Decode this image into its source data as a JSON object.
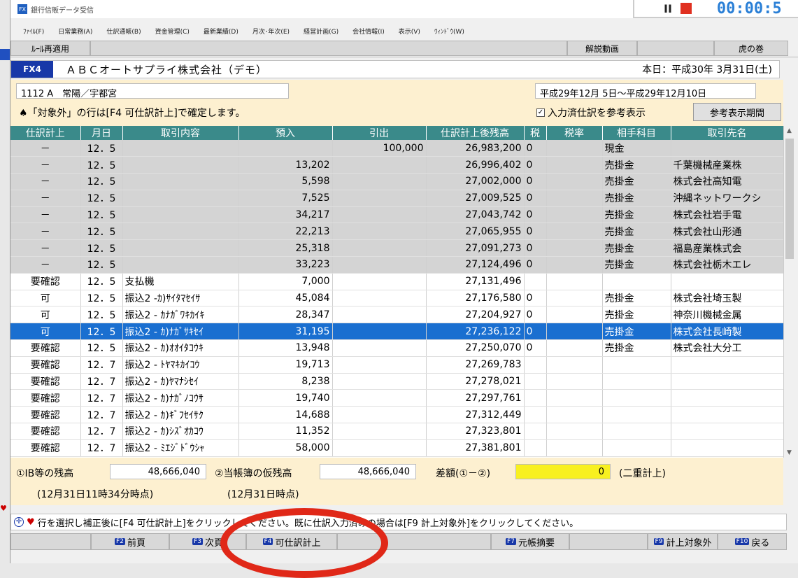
{
  "window": {
    "title": "銀行信販データ受信"
  },
  "timer": {
    "time": "00:00:5"
  },
  "menu": [
    "ﾌｧｲﾙ(F)",
    "日常業務(A)",
    "仕訳通帳(B)",
    "資金管理(C)",
    "最新業績(D)",
    "月次･年次(E)",
    "経営計画(G)",
    "会社情報(I)",
    "表示(V)",
    "ｳｨﾝﾄﾞｳ(W)"
  ],
  "toolbar": {
    "reapply": "ﾙｰﾙ再適用",
    "video": "解説動画",
    "tora": "虎の巻"
  },
  "header": {
    "code": "FX4",
    "company": "ＡＢＣオートサプライ株式会社（デモ）",
    "today": "本日：平成30年 3月31日(土)"
  },
  "filters": {
    "account": "1112 A　常陽／宇都宮",
    "period": "平成29年12月 5日～平成29年12月10日",
    "note": "♠「対象外」の行は[F4 可仕訳計上]で確定します。",
    "checkbox": "入力済仕訳を参考表示",
    "ref_button": "参考表示期間"
  },
  "columns": [
    "仕訳計上",
    "月日",
    "取引内容",
    "預入",
    "引出",
    "仕訳計上後残高",
    "税",
    "税率",
    "相手科目",
    "取引先名"
  ],
  "rows": [
    {
      "status": "－",
      "date": "12．5",
      "desc": "",
      "dep": "",
      "wd": "100,000",
      "bal": "26,983,200",
      "tax": "0",
      "rate": "",
      "acct": "現金",
      "partner": "",
      "style": "gray"
    },
    {
      "status": "－",
      "date": "12．5",
      "desc": "",
      "dep": "13,202",
      "wd": "",
      "bal": "26,996,402",
      "tax": "0",
      "rate": "",
      "acct": "売掛金",
      "partner": "千葉機械産業株",
      "style": "gray"
    },
    {
      "status": "－",
      "date": "12．5",
      "desc": "",
      "dep": "5,598",
      "wd": "",
      "bal": "27,002,000",
      "tax": "0",
      "rate": "",
      "acct": "売掛金",
      "partner": "株式会社高知電",
      "style": "gray"
    },
    {
      "status": "－",
      "date": "12．5",
      "desc": "",
      "dep": "7,525",
      "wd": "",
      "bal": "27,009,525",
      "tax": "0",
      "rate": "",
      "acct": "売掛金",
      "partner": "沖縄ネットワークシ",
      "style": "gray"
    },
    {
      "status": "－",
      "date": "12．5",
      "desc": "",
      "dep": "34,217",
      "wd": "",
      "bal": "27,043,742",
      "tax": "0",
      "rate": "",
      "acct": "売掛金",
      "partner": "株式会社岩手電",
      "style": "gray"
    },
    {
      "status": "－",
      "date": "12．5",
      "desc": "",
      "dep": "22,213",
      "wd": "",
      "bal": "27,065,955",
      "tax": "0",
      "rate": "",
      "acct": "売掛金",
      "partner": "株式会社山形通",
      "style": "gray"
    },
    {
      "status": "－",
      "date": "12．5",
      "desc": "",
      "dep": "25,318",
      "wd": "",
      "bal": "27,091,273",
      "tax": "0",
      "rate": "",
      "acct": "売掛金",
      "partner": "福島産業株式会",
      "style": "gray"
    },
    {
      "status": "－",
      "date": "12．5",
      "desc": "",
      "dep": "33,223",
      "wd": "",
      "bal": "27,124,496",
      "tax": "0",
      "rate": "",
      "acct": "売掛金",
      "partner": "株式会社栃木エレ",
      "style": "gray"
    },
    {
      "status": "要確認",
      "date": "12．5",
      "desc": "支払機",
      "dep": "7,000",
      "wd": "",
      "bal": "27,131,496",
      "tax": "",
      "rate": "",
      "acct": "",
      "partner": "",
      "style": ""
    },
    {
      "status": "可",
      "date": "12．5",
      "desc": "振込2 -ｶ)ｻｲﾀﾏｾｲｻ",
      "dep": "45,084",
      "wd": "",
      "bal": "27,176,580",
      "tax": "0",
      "rate": "",
      "acct": "売掛金",
      "partner": "株式会社埼玉製",
      "style": ""
    },
    {
      "status": "可",
      "date": "12．5",
      "desc": "振込2 - ｶﾅｶﾞﾜｷｶｲｷ",
      "dep": "28,347",
      "wd": "",
      "bal": "27,204,927",
      "tax": "0",
      "rate": "",
      "acct": "売掛金",
      "partner": "神奈川機械金属",
      "style": ""
    },
    {
      "status": "可",
      "date": "12．5",
      "desc": "振込2 - ｶ)ﾅｶﾞｻｷｾｲ",
      "dep": "31,195",
      "wd": "",
      "bal": "27,236,122",
      "tax": "0",
      "rate": "",
      "acct": "売掛金",
      "partner": "株式会社長崎製",
      "style": "sel"
    },
    {
      "status": "要確認",
      "date": "12．5",
      "desc": "振込2 - ｶ)ｵｵｲﾀｺｳｷ",
      "dep": "13,948",
      "wd": "",
      "bal": "27,250,070",
      "tax": "0",
      "rate": "",
      "acct": "売掛金",
      "partner": "株式会社大分工",
      "style": ""
    },
    {
      "status": "要確認",
      "date": "12．7",
      "desc": "振込2 - ﾄﾔﾏｷｶｲｺｳ",
      "dep": "19,713",
      "wd": "",
      "bal": "27,269,783",
      "tax": "",
      "rate": "",
      "acct": "",
      "partner": "",
      "style": ""
    },
    {
      "status": "要確認",
      "date": "12．7",
      "desc": "振込2 - ｶ)ﾔﾏﾅｼｾｲ",
      "dep": "8,238",
      "wd": "",
      "bal": "27,278,021",
      "tax": "",
      "rate": "",
      "acct": "",
      "partner": "",
      "style": ""
    },
    {
      "status": "要確認",
      "date": "12．7",
      "desc": "振込2 - ｶ)ﾅｶﾞﾉｺｳｻ",
      "dep": "19,740",
      "wd": "",
      "bal": "27,297,761",
      "tax": "",
      "rate": "",
      "acct": "",
      "partner": "",
      "style": ""
    },
    {
      "status": "要確認",
      "date": "12．7",
      "desc": "振込2 - ｶ)ｷﾞﾌｾｲｻｸ",
      "dep": "14,688",
      "wd": "",
      "bal": "27,312,449",
      "tax": "",
      "rate": "",
      "acct": "",
      "partner": "",
      "style": ""
    },
    {
      "status": "要確認",
      "date": "12．7",
      "desc": "振込2 - ｶ)ｼｽﾞｵｶｺｳ",
      "dep": "11,352",
      "wd": "",
      "bal": "27,323,801",
      "tax": "",
      "rate": "",
      "acct": "",
      "partner": "",
      "style": ""
    },
    {
      "status": "要確認",
      "date": "12．7",
      "desc": "振込2 - ﾐｴｼﾞﾄﾞｳｼｬ",
      "dep": "58,000",
      "wd": "",
      "bal": "27,381,801",
      "tax": "",
      "rate": "",
      "acct": "",
      "partner": "",
      "style": ""
    }
  ],
  "totals": {
    "ib_label": "①IB等の残高",
    "ib_value": "48,666,040",
    "ib_time": "(12月31日11時34分時点)",
    "book_label": "②当帳簿の仮残高",
    "book_value": "48,666,040",
    "book_time": "(12月31日時点)",
    "diff_label": "差額(①－②)",
    "diff_value": "0",
    "double": "(二重計上)"
  },
  "status": {
    "message": "行を選択し補正後に[F4 可仕訳計上]をクリックしてください。既に仕訳入力済みの場合は[F9 計上対象外]をクリックしてください。"
  },
  "fkeys": [
    {
      "key": "F2",
      "label": "前頁"
    },
    {
      "key": "F3",
      "label": "次頁"
    },
    {
      "key": "F4",
      "label": "可仕訳計上"
    },
    {
      "key": "F7",
      "label": "元帳摘要"
    },
    {
      "key": "F9",
      "label": "計上対象外"
    },
    {
      "key": "F10",
      "label": "戻る"
    }
  ],
  "colors": {
    "header": "#3a8a8a",
    "selected": "#1a6fd0",
    "panel": "#fdf0d0",
    "highlight": "#e02818"
  }
}
